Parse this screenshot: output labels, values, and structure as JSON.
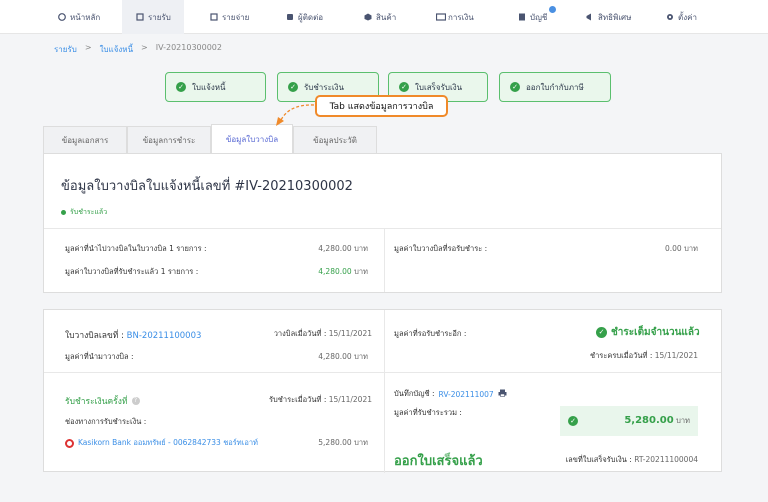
{
  "nav": {
    "items": [
      {
        "label": "หน้าหลัก",
        "icon": "dashboard-icon"
      },
      {
        "label": "รายรับ",
        "icon": "income-icon"
      },
      {
        "label": "รายจ่าย",
        "icon": "expense-icon"
      },
      {
        "label": "ผู้ติดต่อ",
        "icon": "contacts-icon"
      },
      {
        "label": "สินค้า",
        "icon": "product-icon"
      },
      {
        "label": "การเงิน",
        "icon": "finance-icon"
      },
      {
        "label": "บัญชี",
        "icon": "accounting-icon"
      },
      {
        "label": "สิทธิพิเศษ",
        "icon": "megaphone-icon"
      },
      {
        "label": "ตั้งค่า",
        "icon": "gear-icon"
      }
    ]
  },
  "breadcrumb": {
    "root": "รายรับ",
    "sep": ">",
    "parent": "ใบแจ้งหนี้",
    "current": "IV-20210300002"
  },
  "steps": [
    "ใบแจ้งหนี้",
    "รับชำระเงิน",
    "ใบเสร็จรับเงิน",
    "ออกใบกำกับภาษี"
  ],
  "callout": "Tab แสดงข้อมูลการวางบิล",
  "tabs": [
    "ข้อมูลเอกสาร",
    "ข้อมูลการชำระ",
    "ข้อมูลใบวางบิล",
    "ข้อมูลประวัติ"
  ],
  "summary": {
    "title": "ข้อมูลใบวางบิลใบแจ้งหนี้เลขที่ #IV-20210300002",
    "status": "รับชำระแล้ว",
    "billed_label": "มูลค่าที่นำไปวางบิลในใบวางบิล 1 รายการ :",
    "billed_value": "4,280.00",
    "paid_label": "มูลค่าใบวางบิลที่รับชำระแล้ว 1 รายการ :",
    "paid_value": "4,280.00",
    "pending_label": "มูลค่าใบวางบิลที่รอรับชำระ :",
    "pending_value": "0.00",
    "unit": "บาท"
  },
  "bill": {
    "no_label": "ใบวางบิลเลขที่ :",
    "no_value": "BN-20211100003",
    "date_label": "วางบิลเมื่อวันที่ :",
    "date_value": "15/11/2021",
    "amount_label": "มูลค่าที่นำมาวางบิล :",
    "amount_value": "4,280.00",
    "unit": "บาท",
    "awaiting_label": "มูลค่าที่รอรับชำระอีก :",
    "full_paid": "ชำระเต็มจำนวนแล้ว",
    "full_date_label": "ชำระครบเมื่อวันที่ :",
    "full_date_value": "15/11/2021",
    "receive_label": "รับชำระเงินครั้งที่",
    "receive_date_label": "รับชำระเมื่อวันที่ :",
    "receive_date_value": "15/11/2021",
    "channel_label": "ช่องทางการรับชำระเงิน :",
    "channel_value": "Kasikorn Bank ออมทรัพย์ - 0062842733 ชอร์ทเอาท์",
    "channel_amount": "5,280.00",
    "journal_label": "บันทึกบัญชี :",
    "journal_value": "RV-202111007",
    "total_label": "มูลค่าที่รับชำระรวม :",
    "total_value": "5,280.00",
    "receipt_done": "ออกใบเสร็จแล้ว",
    "receipt_no_label": "เลขที่ใบเสร็จรับเงิน :",
    "receipt_no_value": "RT-20211100004"
  }
}
